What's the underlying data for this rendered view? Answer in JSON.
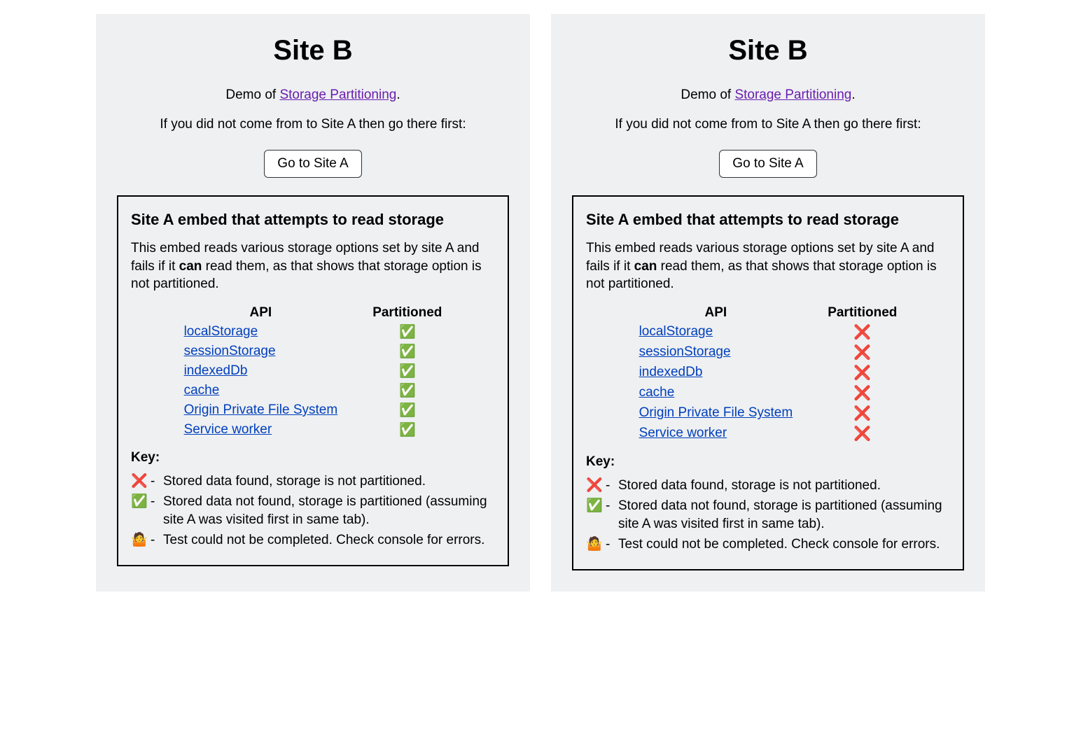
{
  "panels": [
    {
      "title": "Site B",
      "demo_prefix": "Demo of ",
      "demo_link": "Storage Partitioning",
      "demo_suffix": ".",
      "instruction": "If you did not come from to Site A then go there first:",
      "button_label": "Go to Site A",
      "embed": {
        "heading": "Site A embed that attempts to read storage",
        "desc_1": "This embed reads various storage options set by site A and fails if it ",
        "desc_bold": "can",
        "desc_2": " read them, as that shows that storage option is not partitioned.",
        "col_api": "API",
        "col_partitioned": "Partitioned",
        "rows": [
          {
            "api": "localStorage",
            "status": "✅"
          },
          {
            "api": "sessionStorage",
            "status": "✅"
          },
          {
            "api": "indexedDb",
            "status": "✅"
          },
          {
            "api": "cache",
            "status": "✅"
          },
          {
            "api": "Origin Private File System",
            "status": "✅"
          },
          {
            "api": "Service worker",
            "status": "✅"
          }
        ],
        "key_label": "Key:",
        "keys": [
          {
            "icon": "❌",
            "text": "Stored data found, storage is not partitioned."
          },
          {
            "icon": "✅",
            "text": "Stored data not found, storage is partitioned (assuming site A was visited first in same tab)."
          },
          {
            "icon": "🤷",
            "text": "Test could not be completed. Check console for errors."
          }
        ]
      }
    },
    {
      "title": "Site B",
      "demo_prefix": "Demo of ",
      "demo_link": "Storage Partitioning",
      "demo_suffix": ".",
      "instruction": "If you did not come from to Site A then go there first:",
      "button_label": "Go to Site A",
      "embed": {
        "heading": "Site A embed that attempts to read storage",
        "desc_1": "This embed reads various storage options set by site A and fails if it ",
        "desc_bold": "can",
        "desc_2": " read them, as that shows that storage option is not partitioned.",
        "col_api": "API",
        "col_partitioned": "Partitioned",
        "rows": [
          {
            "api": "localStorage",
            "status": "❌"
          },
          {
            "api": "sessionStorage",
            "status": "❌"
          },
          {
            "api": "indexedDb",
            "status": "❌"
          },
          {
            "api": "cache",
            "status": "❌"
          },
          {
            "api": "Origin Private File System",
            "status": "❌"
          },
          {
            "api": "Service worker",
            "status": "❌"
          }
        ],
        "key_label": "Key:",
        "keys": [
          {
            "icon": "❌",
            "text": "Stored data found, storage is not partitioned."
          },
          {
            "icon": "✅",
            "text": "Stored data not found, storage is partitioned (assuming site A was visited first in same tab)."
          },
          {
            "icon": "🤷",
            "text": "Test could not be completed. Check console for errors."
          }
        ]
      }
    }
  ]
}
